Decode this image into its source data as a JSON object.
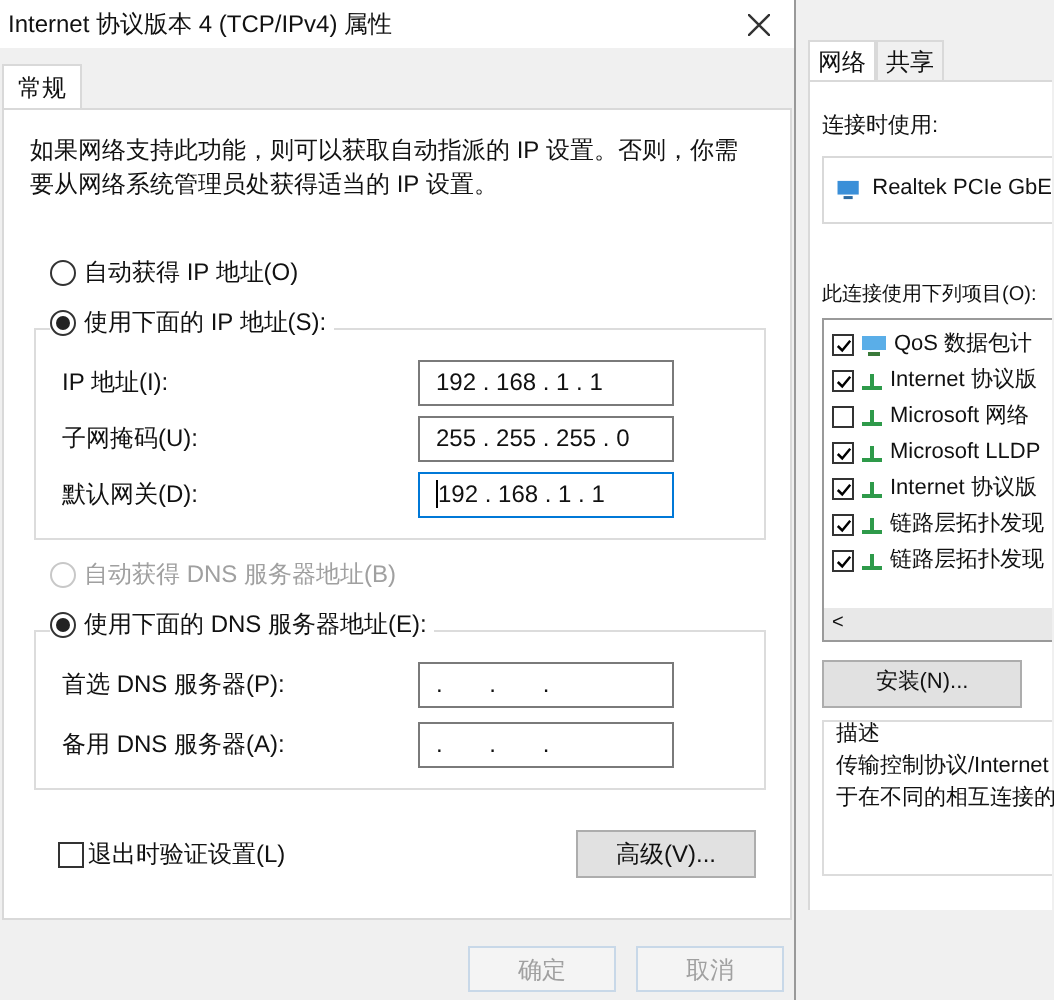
{
  "dialog": {
    "title": "Internet 协议版本 4 (TCP/IPv4) 属性",
    "tabs": [
      {
        "label": "常规",
        "selected": true
      }
    ],
    "intro": "如果网络支持此功能，则可以获取自动指派的 IP 设置。否则，你需要从网络系统管理员处获得适当的 IP 设置。",
    "ip_mode": [
      {
        "label": "自动获得 IP 地址(O)",
        "selected": false,
        "disabled": false
      },
      {
        "label": "使用下面的 IP 地址(S):",
        "selected": true,
        "disabled": false
      }
    ],
    "ip_fields": [
      {
        "label": "IP 地址(I):",
        "value": "192 . 168 . 1 . 1",
        "focused": false
      },
      {
        "label": "子网掩码(U):",
        "value": "255 . 255 . 255 . 0",
        "focused": false
      },
      {
        "label": "默认网关(D):",
        "value": "192 . 168 . 1 . 1",
        "focused": true
      }
    ],
    "dns_mode": [
      {
        "label": "自动获得 DNS 服务器地址(B)",
        "selected": false,
        "disabled": true
      },
      {
        "label": "使用下面的 DNS 服务器地址(E):",
        "selected": true,
        "disabled": false
      }
    ],
    "dns_fields": [
      {
        "label": "首选 DNS 服务器(P):",
        "value": ".       .       ."
      },
      {
        "label": "备用 DNS 服务器(A):",
        "value": ".       .       ."
      }
    ],
    "validate": {
      "label": "退出时验证设置(L)",
      "checked": false
    },
    "advanced_button": "高级(V)...",
    "buttons": [
      {
        "label": "确定",
        "disabled": true
      },
      {
        "label": "取消",
        "disabled": true
      }
    ]
  },
  "background_window": {
    "tabs": [
      {
        "label": "网络",
        "selected": true
      },
      {
        "label": "共享",
        "selected": false
      }
    ],
    "connect_using_label": "连接时使用:",
    "adapter": "Realtek PCIe GbE",
    "items_label": "此连接使用下列项目(O):",
    "items": [
      {
        "label": "QoS 数据包计",
        "checked": true,
        "kind": "service"
      },
      {
        "label": "Internet 协议版",
        "checked": true,
        "kind": "protocol"
      },
      {
        "label": "Microsoft 网络",
        "checked": false,
        "kind": "protocol"
      },
      {
        "label": "Microsoft LLDP",
        "checked": true,
        "kind": "protocol"
      },
      {
        "label": "Internet 协议版",
        "checked": true,
        "kind": "protocol"
      },
      {
        "label": "链路层拓扑发现",
        "checked": true,
        "kind": "protocol"
      },
      {
        "label": "链路层拓扑发现",
        "checked": true,
        "kind": "protocol"
      }
    ],
    "scroll_left": "<",
    "install_button": "安装(N)...",
    "description_label": "描述",
    "description_lines": [
      "传输控制协议/Internet",
      "于在不同的相互连接的"
    ]
  }
}
